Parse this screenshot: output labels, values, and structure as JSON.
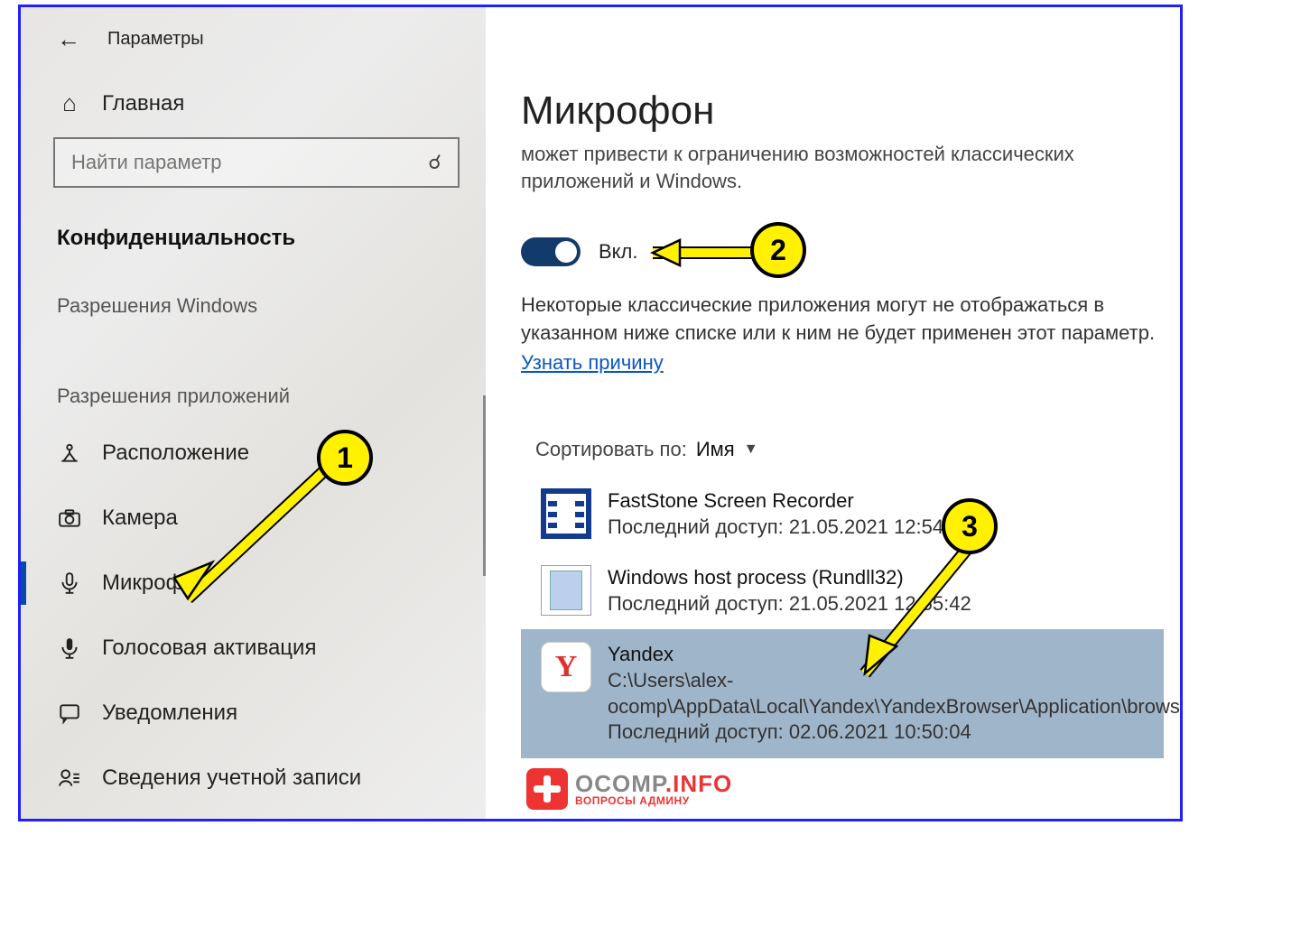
{
  "window": {
    "title": "Параметры"
  },
  "sidebar": {
    "home_label": "Главная",
    "search_placeholder": "Найти параметр",
    "section_current": "Конфиденциальность",
    "group_windows": "Разрешения Windows",
    "group_apps": "Разрешения приложений",
    "items": [
      {
        "label": "Расположение"
      },
      {
        "label": "Камера"
      },
      {
        "label": "Микрофон"
      },
      {
        "label": "Голосовая активация"
      },
      {
        "label": "Уведомления"
      },
      {
        "label": "Сведения учетной записи"
      }
    ]
  },
  "main": {
    "title": "Микрофон",
    "trunc_para": "может привести к ограничению возможностей классических приложений и Windows.",
    "toggle_label": "Вкл.",
    "toggle_on": true,
    "note": "Некоторые классические приложения могут не отображаться в указанном ниже списке или к ним не будет применен этот параметр.",
    "link": "Узнать причину",
    "sort_label": "Сортировать по:",
    "sort_value": "Имя",
    "apps": [
      {
        "name": "FastStone Screen Recorder",
        "last_access_label": "Последний доступ:",
        "last_access": "21.05.2021 12:54:12",
        "icon": "film"
      },
      {
        "name": "Windows host process (Rundll32)",
        "last_access_label": "Последний доступ:",
        "last_access": "21.05.2021 12:55:42",
        "icon": "file"
      },
      {
        "name": "Yandex",
        "path": "C:\\Users\\alex-ocomp\\AppData\\Local\\Yandex\\YandexBrowser\\Application\\browser.exe",
        "last_access_label": "Последний доступ:",
        "last_access": "02.06.2021 10:50:04",
        "icon": "yandex",
        "selected": true
      }
    ]
  },
  "annotations": {
    "markers": [
      "1",
      "2",
      "3"
    ]
  },
  "watermark": {
    "brand_gray": "OCOMP",
    "brand_red": ".INFO",
    "tagline": "ВОПРОСЫ АДМИНУ"
  }
}
